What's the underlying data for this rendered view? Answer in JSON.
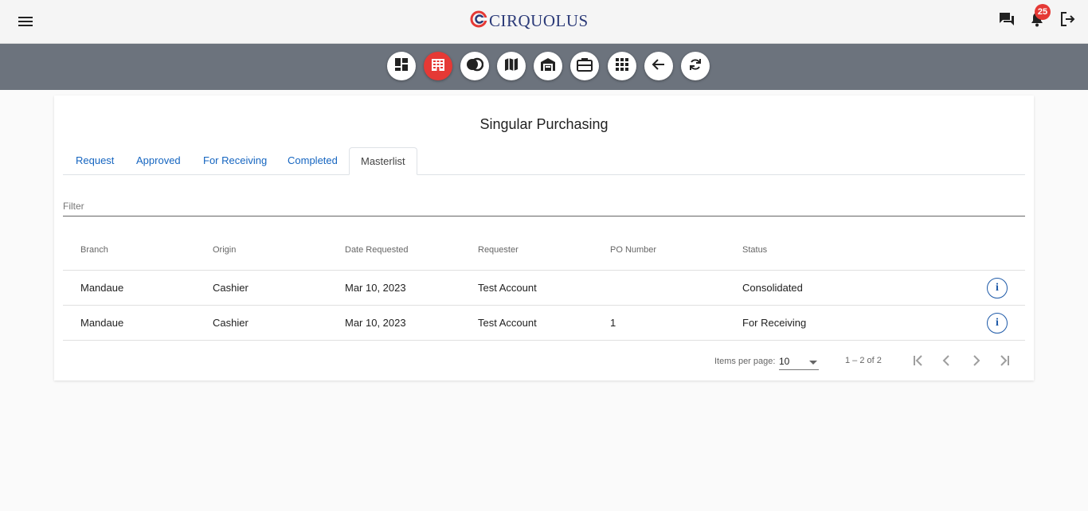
{
  "header": {
    "logo_text": "CIRQUOLUS",
    "notification_count": "25",
    "brand_color": "#e53935"
  },
  "toolbar": {
    "buttons": [
      "dashboard-icon",
      "building-icon",
      "coins-icon",
      "map-icon",
      "warehouse-icon",
      "briefcase-icon",
      "apps-grid-icon",
      "back-arrow-icon",
      "refresh-icon"
    ],
    "active": "building-icon"
  },
  "page": {
    "title": "Singular Purchasing",
    "tabs": [
      "Request",
      "Approved",
      "For Receiving",
      "Completed",
      "Masterlist"
    ],
    "active_tab": "Masterlist",
    "filter_placeholder": "Filter"
  },
  "table": {
    "headers": [
      "Branch",
      "Origin",
      "Date Requested",
      "Requester",
      "PO Number",
      "Status"
    ],
    "rows": [
      [
        "Mandaue",
        "Cashier",
        "Mar 10, 2023",
        "Test Account",
        "",
        "Consolidated"
      ],
      [
        "Mandaue",
        "Cashier",
        "Mar 10, 2023",
        "Test Account",
        "1",
        "For Receiving"
      ]
    ],
    "row_action_icon": "info-icon"
  },
  "paginator": {
    "items_per_page_label": "Items per page:",
    "items_per_page": "10",
    "range": "1 – 2 of 2"
  }
}
